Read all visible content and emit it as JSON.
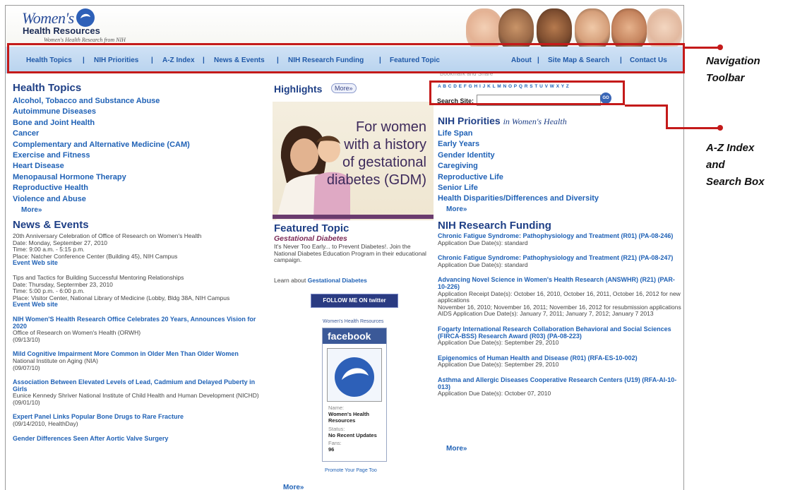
{
  "header": {
    "logo_title": "Women's",
    "logo_subtitle": "Health Resources",
    "logo_tagline": "Women's Health Research from NIH"
  },
  "nav": {
    "left": [
      "Health Topics",
      "NIH Priorities",
      "A-Z Index",
      "News & Events",
      "NIH Research Funding",
      "Featured Topic"
    ],
    "right": [
      "About",
      "Site Map & Search",
      "Contact Us"
    ],
    "separator": "|"
  },
  "callouts": {
    "nav_line1": "Navigation",
    "nav_line2": "Toolbar",
    "az_line1": "A-Z Index",
    "az_line2": "and",
    "az_line3": "Search Box"
  },
  "health_topics": {
    "title": "Health Topics",
    "items": [
      "Alcohol, Tobacco and Substance Abuse",
      "Autoimmune Diseases",
      "Bone and Joint Health",
      "Cancer",
      "Complementary and Alternative Medicine (CAM)",
      "Exercise and Fitness",
      "Heart Disease",
      "Menopausal Hormone Therapy",
      "Reproductive Health",
      "Violence and Abuse"
    ],
    "more": "More»"
  },
  "news": {
    "title": "News & Events",
    "event1_title": "20th Anniversary Celebration of Office of Research on Women's Health",
    "event1_date": "Date: Monday, September 27, 2010",
    "event1_time": "Time: 9:00 a.m. - 5:15 p.m.",
    "event1_place": "Place: Natcher Conference Center (Building 45), NIH Campus",
    "event1_link": "Event Web site",
    "event2_title": "Tips and Tactics for Building Successful Mentoring Relationships",
    "event2_date": "Date: Thursday, Septermber 23, 2010",
    "event2_time": "Time: 5:00 p.m. - 6:00 p.m.",
    "event2_place": "Place: Visitor Center, National Library of Medicine (Lobby, Bldg 38A, NIH Campus",
    "event2_link": "Event Web site",
    "item1_title": "NIH Women'S Health Research Office Celebrates 20 Years, Announces Vision for 2020",
    "item1_source": "Office of Research on Women's Health (ORWH)",
    "item1_date": "(09/13/10)",
    "item2_title": "Mild Cognitive Impairment More Common in Older Men Than Older Women",
    "item2_source": "National Institute on Aging (NIA)",
    "item2_date": "(09/07/10)",
    "item3_title": "Association Between Elevated Levels of Lead, Cadmium and Delayed Puberty in Girls",
    "item3_source": "Eunice Kennedy Shriver National Institute of Child Health and Human Development (NICHD)",
    "item3_date": "(09/01/10)",
    "item4_title": "Expert Panel Links Popular Bone Drugs to Rare Fracture",
    "item4_source": "(09/14/2010, HealthDay)",
    "item5_title": "Gender Differences Seen After Aortic Valve Surgery"
  },
  "highlights": {
    "title": "Highlights",
    "more": "More»",
    "image_text": [
      "For women",
      "with a history",
      "of gestational",
      "diabetes (GDM)"
    ]
  },
  "featured": {
    "title": "Featured Topic",
    "subtitle": "Gestational Diabetes",
    "body": "It's Never Too Early... to Prevent Diabetes!. Join the National Diabetes Education Program in their educational campaign.",
    "learn_prefix": "Learn about",
    "learn_link": "Gestational Diabetes",
    "twitter": "FOLLOW ME ON twitter",
    "fb_caption": "Women's Health Resources",
    "fb_head": "facebook",
    "fb_name_label": "Name:",
    "fb_name": "Women's Health Resources",
    "fb_status_label": "Status:",
    "fb_status": "No Recent Updates",
    "fb_fans_label": "Fans:",
    "fb_fans": "96",
    "fb_promote": "Promote Your Page Too",
    "more": "More»"
  },
  "search": {
    "bookmark": "Bookmark and Share",
    "az": "A B C D E F G H I J K L M N O P Q R S T U V W X Y Z",
    "label": "Search Site:",
    "placeholder": "",
    "go": "GO"
  },
  "priorities": {
    "title": "NIH Priorities",
    "title_suffix": "in Women's Health",
    "items": [
      "Life Span",
      "Early Years",
      "Gender Identity",
      "Caregiving",
      "Reproductive Life",
      "Senior Life",
      "Health Disparities/Differences and Diversity"
    ],
    "more": "More»"
  },
  "funding": {
    "title": "NIH Research Funding",
    "f1_title": "Chronic Fatigue Syndrome: Pathophysiology and Treatment (R01) (PA-08-246)",
    "f1_due": "Application Due Date(s): standard",
    "f2_title": "Chronic Fatigue Syndrome: Pathophysiology and Treatment (R21) (PA-08-247)",
    "f2_due": "Application Due Date(s): standard",
    "f3_title": "Advancing Novel Science in Women's Health Research (ANSWHR) (R21) (PAR-10-226)",
    "f3_due": "Application Receipt Date(s): October 16, 2010, October 16, 2011, October 16, 2012 for new applications",
    "f3_due2": "November 16, 2010; November 16, 2011; November 16, 2012 for resubmission applications",
    "f3_due3": "AIDS Application Due Date(s): January 7, 2011; January 7, 2012; January 7 2013",
    "f4_title": "Fogarty International Research Collaboration Behavioral and Social Sciences (FIRCA-BSS) Research Award (R03) (PA-08-223)",
    "f4_due": "Application Due Date(s): September 29, 2010",
    "f5_title": "Epigenomics of Human Health and Disease (R01) (RFA-ES-10-002)",
    "f5_due": "Application Due Date(s): September 29, 2010",
    "f6_title": "Asthma and Allergic Diseases Cooperative Research Centers (U19) (RFA-AI-10-013)",
    "f6_due": "Application Due Date(s): October 07, 2010",
    "more": "More»"
  },
  "colors": {
    "accent": "#c41a1a",
    "link": "#2062b6",
    "nav_bg": "#c4daf2",
    "heading": "#1e3f86"
  }
}
